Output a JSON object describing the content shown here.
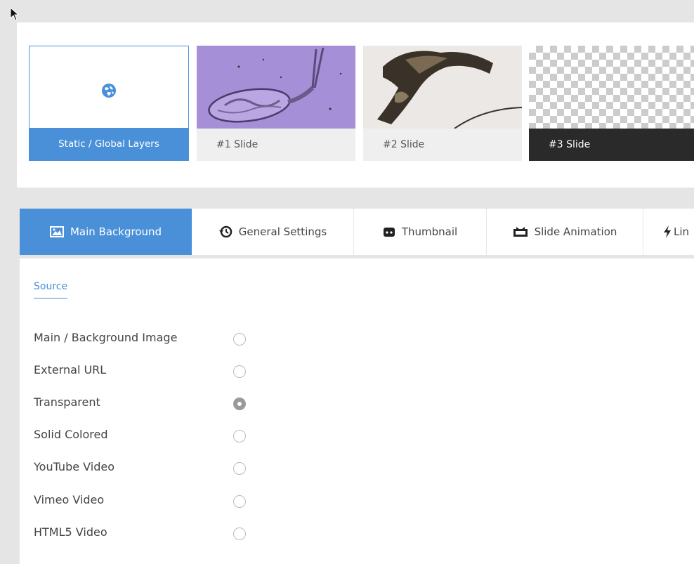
{
  "slides": [
    {
      "label": "Static / Global Layers"
    },
    {
      "label": "#1 Slide"
    },
    {
      "label": "#2 Slide"
    },
    {
      "label": "#3 Slide"
    }
  ],
  "tabs": [
    {
      "label": "Main Background",
      "icon": "image-icon"
    },
    {
      "label": "General Settings",
      "icon": "history-icon"
    },
    {
      "label": "Thumbnail",
      "icon": "robot-icon"
    },
    {
      "label": "Slide Animation",
      "icon": "transition-icon"
    },
    {
      "label": "Lin",
      "icon": "bolt-icon"
    }
  ],
  "section": {
    "label": "Source"
  },
  "source_options": [
    {
      "label": "Main / Background Image",
      "checked": false
    },
    {
      "label": "External URL",
      "checked": false
    },
    {
      "label": "Transparent",
      "checked": true
    },
    {
      "label": "Solid Colored",
      "checked": false
    },
    {
      "label": "YouTube Video",
      "checked": false
    },
    {
      "label": "Vimeo Video",
      "checked": false
    },
    {
      "label": "HTML5 Video",
      "checked": false
    }
  ],
  "colors": {
    "accent": "#4a90d9",
    "dark": "#2a2a2a",
    "background": "#e5e5e5"
  }
}
